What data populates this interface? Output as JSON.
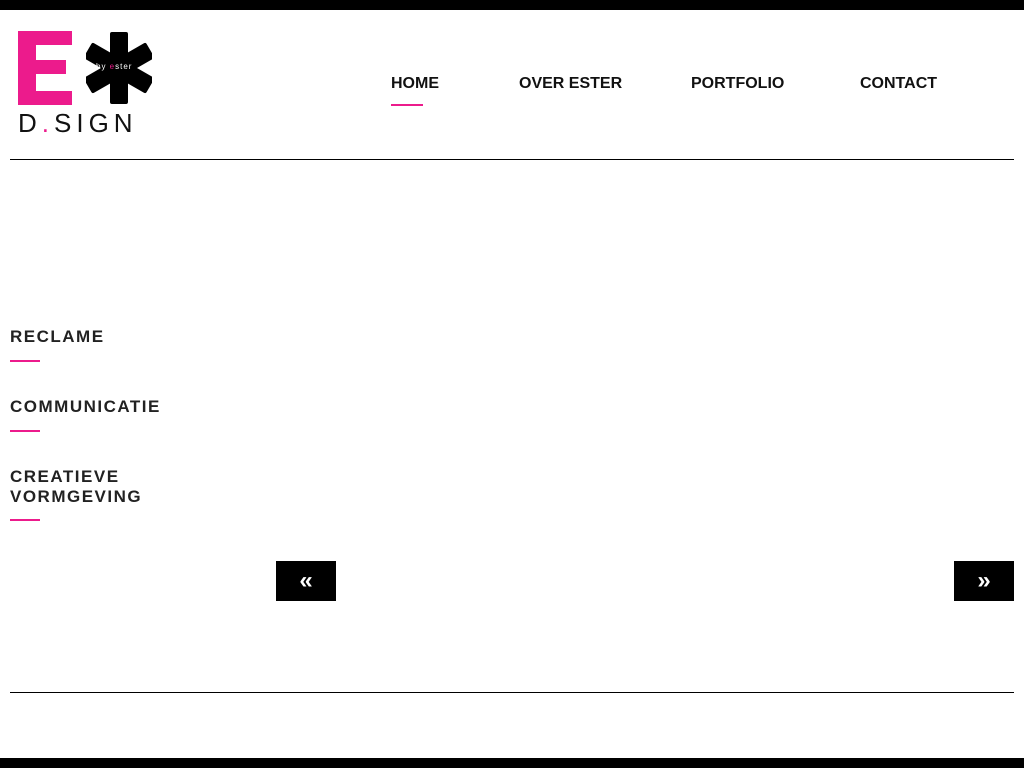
{
  "logo": {
    "letter": "E",
    "by_prefix": "by ",
    "by_highlight": "e",
    "by_suffix": "ster",
    "dsign_start": "D",
    "dsign_dot": ".",
    "dsign_end": "SIGN",
    "brand_color": "#ec1b8c"
  },
  "nav": {
    "items": [
      {
        "label": "HOME",
        "active": true
      },
      {
        "label": "OVER ESTER",
        "active": false
      },
      {
        "label": "PORTFOLIO",
        "active": false
      },
      {
        "label": "CONTACT",
        "active": false
      }
    ]
  },
  "categories": [
    {
      "label": "RECLAME"
    },
    {
      "label": "COMMUNICATIE"
    },
    {
      "label": "CREATIEVE VORMGEVING"
    }
  ],
  "slider": {
    "prev_icon": "«",
    "next_icon": "»"
  }
}
